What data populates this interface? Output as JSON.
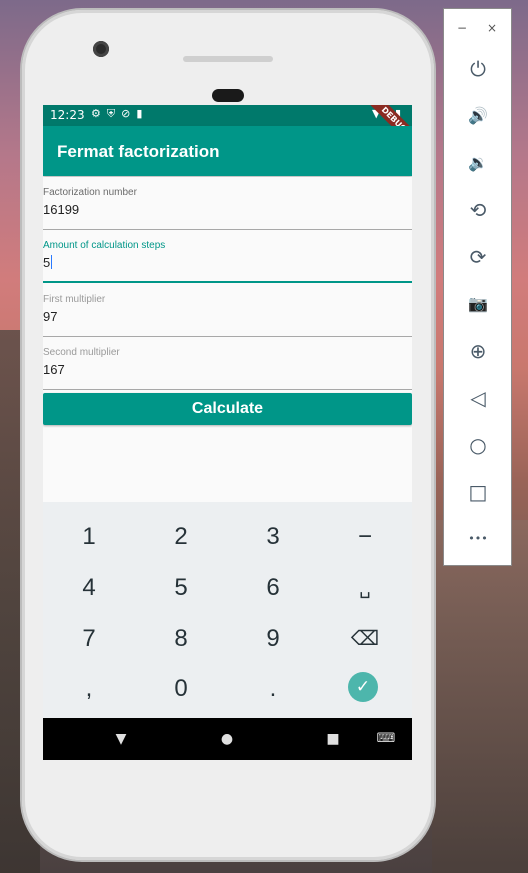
{
  "app": {
    "title": "Fermat factorization",
    "debug_banner": "DEBUG",
    "accent_color": "#009688"
  },
  "statusbar": {
    "time": "12:23",
    "left_icons": [
      "gear-icon",
      "shield-icon",
      "block-icon",
      "sdcard-icon"
    ],
    "right_icons": [
      "wifi-icon",
      "signal-icon",
      "battery-icon"
    ]
  },
  "fields": [
    {
      "label": "Factorization number",
      "value": "16199"
    },
    {
      "label": "Amount of calculation steps",
      "value": "5"
    },
    {
      "label": "First multiplier",
      "value": "97"
    },
    {
      "label": "Second multiplier",
      "value": "167"
    }
  ],
  "calculate_label": "Calculate",
  "keyboard": {
    "rows": [
      [
        "1",
        "2",
        "3",
        "−"
      ],
      [
        "4",
        "5",
        "6",
        "␣"
      ],
      [
        "7",
        "8",
        "9",
        "⌫"
      ],
      [
        ",",
        "0",
        ".",
        "✓"
      ]
    ]
  },
  "navbar": {
    "back": "▼",
    "home": "●",
    "recents": "■",
    "keyboard": "⌨"
  },
  "side_panel": {
    "minimize": "−",
    "close": "×",
    "buttons": [
      {
        "name": "power-icon",
        "glyph": "⏻"
      },
      {
        "name": "volume-up-icon",
        "glyph": "🔊"
      },
      {
        "name": "volume-down-icon",
        "glyph": "🔉"
      },
      {
        "name": "rotate-left-icon",
        "glyph": "⟲"
      },
      {
        "name": "rotate-right-icon",
        "glyph": "⟳"
      },
      {
        "name": "camera-icon",
        "glyph": "📷"
      },
      {
        "name": "zoom-icon",
        "glyph": "⊕"
      },
      {
        "name": "back-icon",
        "glyph": "◁"
      },
      {
        "name": "home-icon",
        "glyph": "○"
      },
      {
        "name": "overview-icon",
        "glyph": "□"
      },
      {
        "name": "more-icon",
        "glyph": "•••"
      }
    ]
  }
}
